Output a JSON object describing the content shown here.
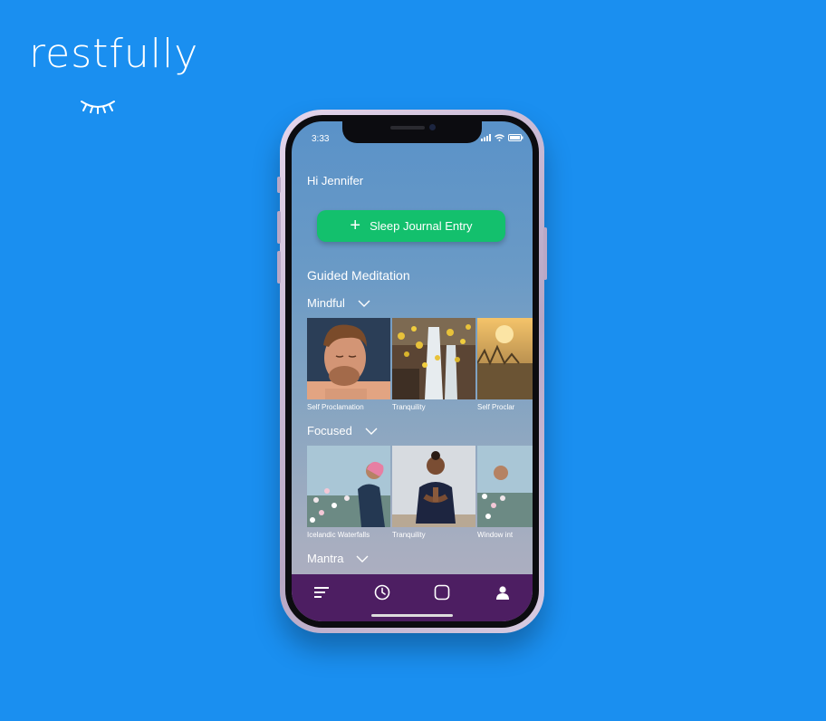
{
  "brand": {
    "name": "restfully",
    "color": "#ffffff",
    "logo_icon": "closed-eye-icon"
  },
  "phone": {
    "status": {
      "time": "3:33",
      "icons": [
        "signal-icon",
        "wifi-icon",
        "battery-icon"
      ]
    },
    "greeting": "Hi Jennifer",
    "journal_button": {
      "label": "Sleep Journal Entry",
      "icon": "plus-icon",
      "color": "#13c06d"
    },
    "section_title": "Guided Meditation",
    "categories": [
      {
        "label": "Mindful",
        "items": [
          {
            "caption": "Self Proclamation",
            "image": "man-portrait"
          },
          {
            "caption": "Tranquility",
            "image": "waterfall-yellow-flowers"
          },
          {
            "caption": "Self Proclar",
            "image": "sunset-field"
          }
        ]
      },
      {
        "label": "Focused",
        "items": [
          {
            "caption": "Icelandic Waterfalls",
            "image": "woman-in-flowers"
          },
          {
            "caption": "Tranquility",
            "image": "woman-meditating"
          },
          {
            "caption": "Window int",
            "image": "flower-field"
          }
        ]
      },
      {
        "label": "Mantra",
        "items": []
      }
    ],
    "nav": {
      "color": "#4d1e62",
      "items": [
        "menu-icon",
        "clock-icon",
        "square-icon",
        "profile-icon"
      ]
    }
  },
  "colors": {
    "background": "#1a8ff0",
    "accent": "#13c06d"
  }
}
